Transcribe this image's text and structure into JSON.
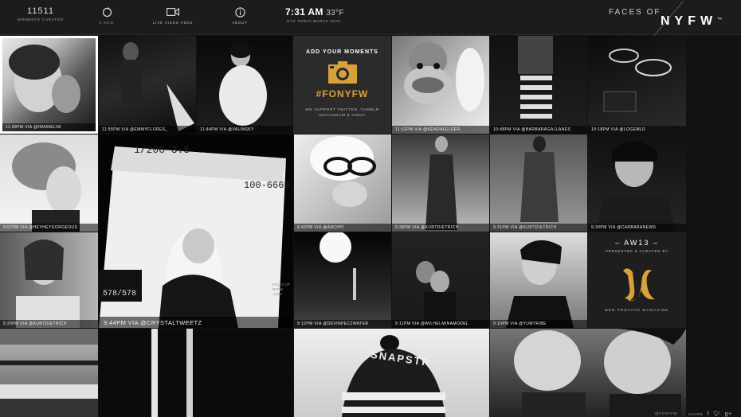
{
  "header": {
    "moments_count": "11511",
    "moments_label": "MOMENTS CURATED",
    "nav": [
      {
        "label": "0 NEW",
        "icon": "refresh-icon"
      },
      {
        "label": "LIVE VIDEO FEED",
        "icon": "video-camera-icon"
      },
      {
        "label": "ABOUT",
        "icon": "info-icon"
      }
    ],
    "time": "7:31 AM",
    "temp": "33°F",
    "date_line": "NYC TODAY MARCH 20TH",
    "brand_faces": "FACES OF",
    "brand_nyfw": "NYFW",
    "brand_tm": "TM"
  },
  "promo": {
    "heading": "ADD YOUR MOMENTS",
    "hashtag": "#FONYFW",
    "support_line1": "WE SUPPORT TWITTER, TUMBLR",
    "support_line2": "INSTAGRAM & VIDDY"
  },
  "aw13": {
    "title": "– AW13 –",
    "presented": "PRESENTED & CURATED BY",
    "magazine": "BEN TROVATO MAGAZINE"
  },
  "tiles": [
    {
      "caption": "11:58PM VIA @HANNELIM"
    },
    {
      "caption": "11:55PM VIA @EMMYFLORES_"
    },
    {
      "caption": "11:44PM VIA @VALINSKY"
    },
    {
      "caption": "11:32PM VIA @KENDALELDER"
    },
    {
      "caption": "10:48PM VIA @BARBARAGALLANES"
    },
    {
      "caption": "10:18PM VIA @LOGEMLR"
    },
    {
      "caption": "9:57PM VIA @HEYHEYGORGEOUS"
    },
    {
      "caption": "9:44PM VIA @CRYSTALTWEETZ"
    },
    {
      "caption": "9:42PM VIA @ANCHYI"
    },
    {
      "caption": "9:38PM VIA @KURTDIETRICH"
    },
    {
      "caption": "9:31PM VIA @KURTDIETRICH"
    },
    {
      "caption": "9:30PM VIA @CARBARANEWS"
    },
    {
      "caption": "9:20PM VIA @KURTDIETRICH"
    },
    {
      "caption": "9:12PM VIA @DEVINPECZWATER"
    },
    {
      "caption": "9:11PM VIA @WILHELMINAMODEL"
    },
    {
      "caption": "9:10PM VIA @YUMTRIBE"
    }
  ],
  "photo_text": {
    "frame_top": "1/200   3.5",
    "frame_num": "100-6669",
    "frame_count": "578/578",
    "watermark": "FACES OF NYFW .COM",
    "beanie": "SNAPSTR"
  },
  "footer": {
    "handle": "@FONYFW",
    "share_label": "SHARE",
    "share_icons": [
      "facebook-icon",
      "twitter-icon",
      "google-plus-icon"
    ]
  },
  "colors": {
    "accent": "#d9a13a"
  }
}
